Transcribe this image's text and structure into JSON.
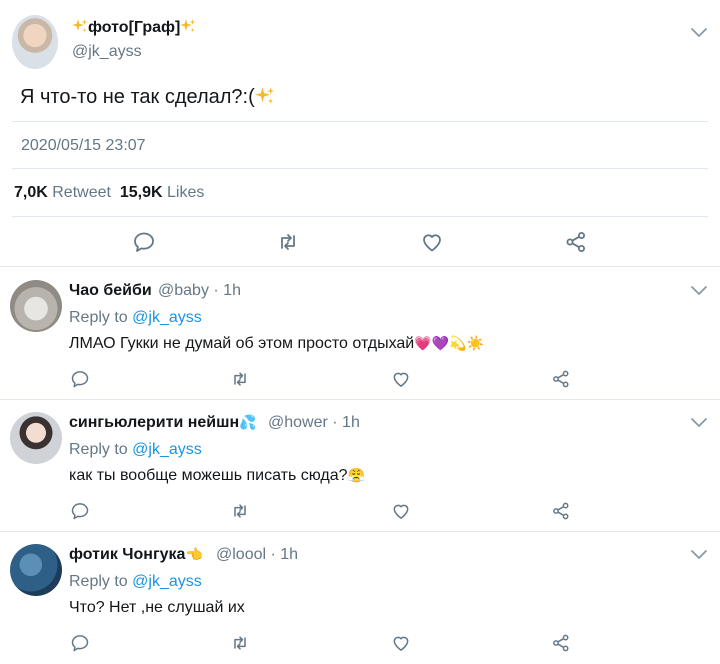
{
  "main_tweet": {
    "display_name": "фото[Граф]",
    "handle": "@jk_ayss",
    "text": "Я что-то не так сделал?:(",
    "timestamp": "2020/05/15 23:07",
    "retweets_count": "7,0K",
    "retweets_label": "Retweet",
    "likes_count": "15,9K",
    "likes_label": "Likes"
  },
  "replies": [
    {
      "display_name": "Чао бейби",
      "handle": "@baby",
      "time": "· 1h",
      "replying_prefix": "Reply to",
      "replying_to": "@jk_ayss",
      "text": "ЛМАО Гукки не думай об этом просто отдыхай",
      "emoji": "💗💜💫☀️"
    },
    {
      "display_name": "сингьюлерити нейшн",
      "handle": "@hower",
      "time": "· 1h",
      "replying_prefix": "Reply to",
      "replying_to": "@jk_ayss",
      "text": "как ты вообще можешь писать сюда?",
      "emoji": "😤"
    },
    {
      "display_name": "фотик Чонгука",
      "handle": "@loool",
      "time": "· 1h",
      "replying_prefix": "Reply to",
      "replying_to": "@jk_ayss",
      "text": "Что? Нет ,не слушай их",
      "emoji": ""
    }
  ],
  "colors": {
    "text": "#14171a",
    "secondary": "#657786",
    "link": "#1b95e0",
    "divider": "#e1e8ed",
    "sparkle": "#f5b82e"
  }
}
